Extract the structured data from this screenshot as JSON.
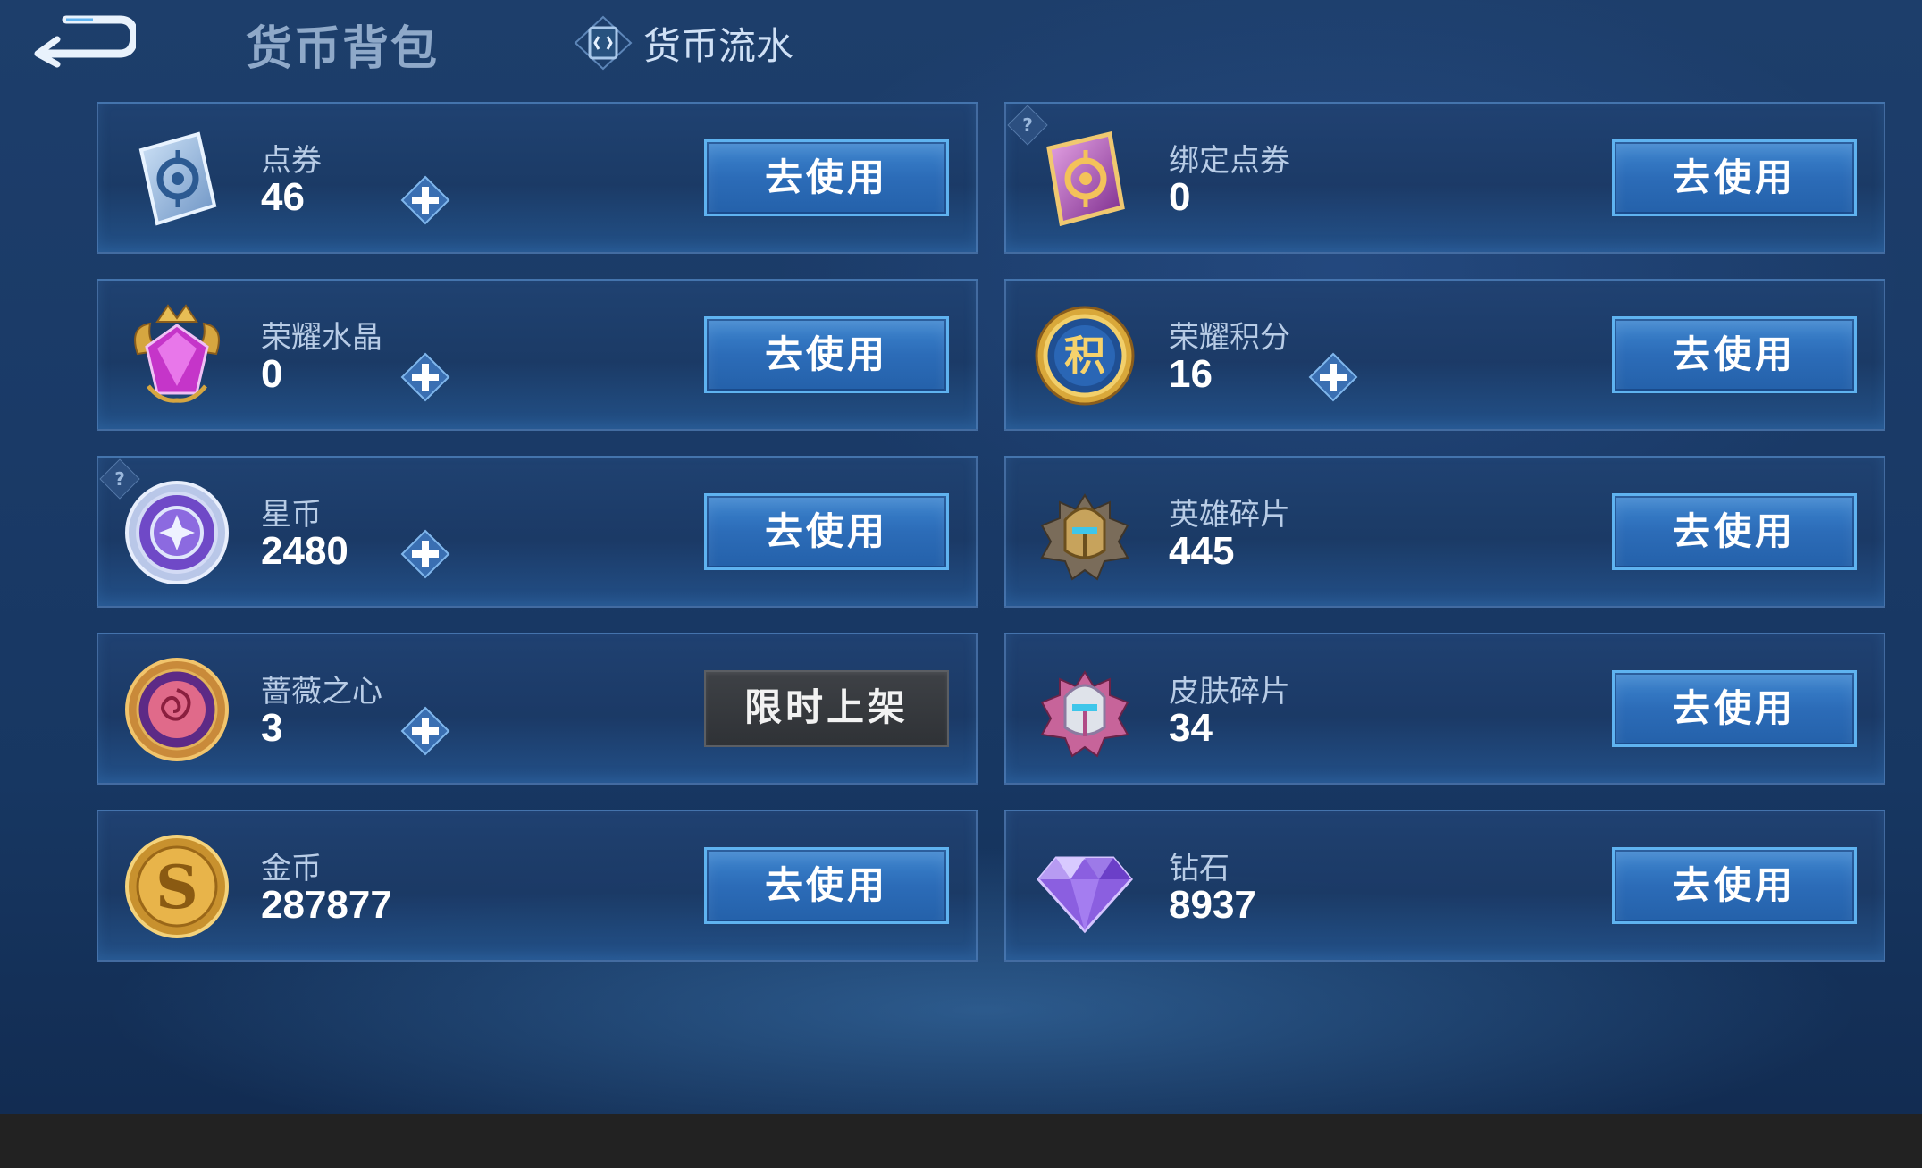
{
  "header": {
    "title": "货币背包",
    "ledger_tab": "货币流水"
  },
  "colors": {
    "accent_button": "#2c6cb8",
    "button_border": "#5fb3f0",
    "limited_button": "#3e4146",
    "background": "#1a3a67"
  },
  "currencies": [
    {
      "name": "点券",
      "amount": "46",
      "button": "去使用",
      "has_plus": true,
      "has_help": false,
      "icon": "voucher-card-icon"
    },
    {
      "name": "绑定点券",
      "amount": "0",
      "button": "去使用",
      "has_plus": false,
      "has_help": true,
      "icon": "bound-voucher-card-icon"
    },
    {
      "name": "荣耀水晶",
      "amount": "0",
      "button": "去使用",
      "has_plus": true,
      "has_help": false,
      "icon": "glory-crystal-icon"
    },
    {
      "name": "荣耀积分",
      "amount": "16",
      "button": "去使用",
      "has_plus": true,
      "has_help": false,
      "icon": "glory-points-icon"
    },
    {
      "name": "星币",
      "amount": "2480",
      "button": "去使用",
      "has_plus": true,
      "has_help": true,
      "icon": "star-coin-icon"
    },
    {
      "name": "英雄碎片",
      "amount": "445",
      "button": "去使用",
      "has_plus": false,
      "has_help": false,
      "icon": "hero-fragment-icon"
    },
    {
      "name": "蔷薇之心",
      "amount": "3",
      "button": "限时上架",
      "has_plus": true,
      "has_help": false,
      "icon": "rose-heart-icon"
    },
    {
      "name": "皮肤碎片",
      "amount": "34",
      "button": "去使用",
      "has_plus": false,
      "has_help": false,
      "icon": "skin-fragment-icon"
    },
    {
      "name": "金币",
      "amount": "287877",
      "button": "去使用",
      "has_plus": false,
      "has_help": false,
      "icon": "gold-coin-icon"
    },
    {
      "name": "钻石",
      "amount": "8937",
      "button": "去使用",
      "has_plus": false,
      "has_help": false,
      "icon": "diamond-icon"
    }
  ]
}
